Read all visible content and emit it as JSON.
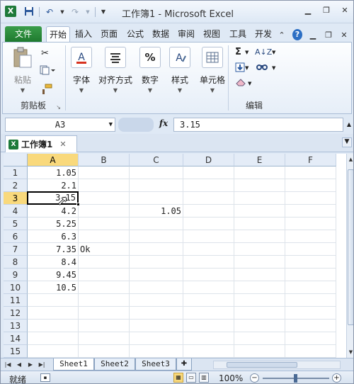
{
  "title_bar": {
    "app_icon": "X",
    "title": "工作簿1 - Microsoft Excel",
    "qat_icons": [
      "save-icon",
      "undo-icon",
      "redo-icon",
      "customize-qat-icon"
    ],
    "controls": [
      "minimize-icon",
      "restore-icon",
      "close-icon"
    ]
  },
  "ribbon_tabs": {
    "file": "文件",
    "tabs": [
      "开始",
      "插入",
      "页面",
      "公式",
      "数据",
      "审阅",
      "视图",
      "工具",
      "开发"
    ],
    "active": "开始"
  },
  "ribbon": {
    "clipboard": {
      "paste_label": "粘贴",
      "group_label": "剪贴板"
    },
    "font": {
      "label": "字体"
    },
    "alignment": {
      "label": "对齐方式"
    },
    "number": {
      "label": "数字"
    },
    "styles": {
      "label": "样式"
    },
    "cells": {
      "label": "单元格"
    },
    "editing": {
      "group_label": "编辑"
    }
  },
  "formula_bar": {
    "name_box": "A3",
    "fx": "fx",
    "formula": "3.15"
  },
  "workbook_tab": {
    "name": "工作簿1",
    "close": "✕"
  },
  "grid": {
    "columns": [
      "A",
      "B",
      "C",
      "D",
      "E",
      "F"
    ],
    "rows": [
      "1",
      "2",
      "3",
      "4",
      "5",
      "6",
      "7",
      "8",
      "9",
      "10",
      "11",
      "12",
      "13",
      "14",
      "15"
    ],
    "selected_column": "A",
    "selected_row": "3",
    "cells": {
      "A1": "1.05",
      "A2": "2.1",
      "A3": "3.15",
      "A4": "4.2",
      "A5": "5.25",
      "A6": "6.3",
      "A7": "7.35",
      "A8": "8.4",
      "A9": "9.45",
      "A10": "10.5",
      "B7": "Ok",
      "C4": "1.05"
    }
  },
  "sheets": {
    "tabs": [
      "Sheet1",
      "Sheet2",
      "Sheet3"
    ],
    "active": "Sheet1"
  },
  "status_bar": {
    "status": "就绪",
    "zoom": "100%",
    "zoom_minus": "−",
    "zoom_plus": "+"
  }
}
